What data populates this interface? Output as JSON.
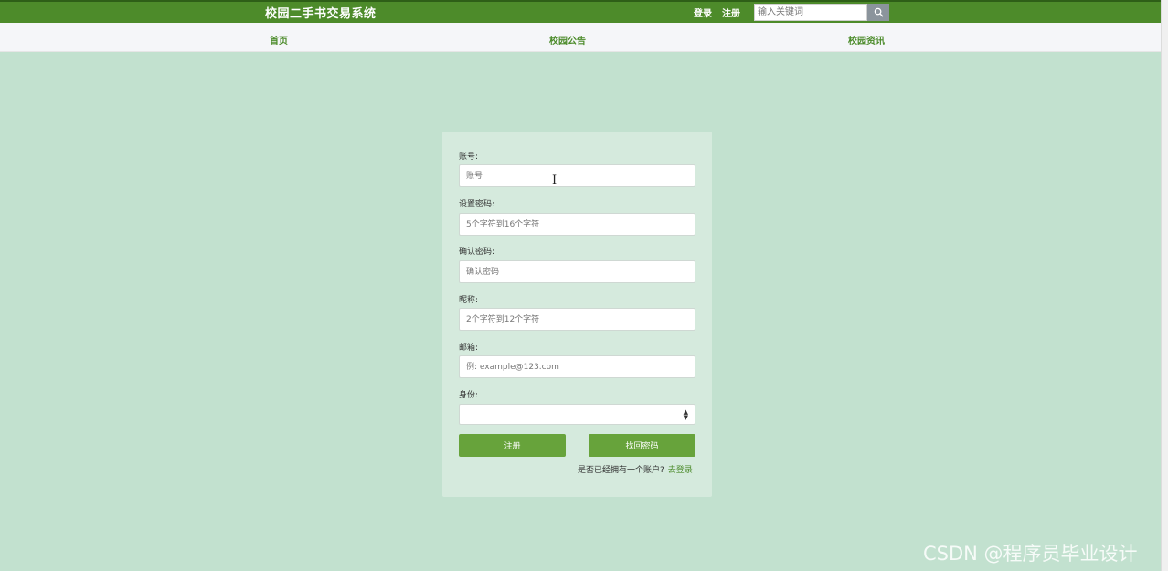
{
  "header": {
    "site_title": "校园二手书交易系统",
    "login_label": "登录",
    "register_label": "注册",
    "search_placeholder": "输入关键词"
  },
  "nav": {
    "items": [
      {
        "label": "首页"
      },
      {
        "label": "校园公告"
      },
      {
        "label": "校园资讯"
      }
    ]
  },
  "form": {
    "fields": [
      {
        "label": "账号:",
        "placeholder": "账号"
      },
      {
        "label": "设置密码:",
        "placeholder": "5个字符到16个字符"
      },
      {
        "label": "确认密码:",
        "placeholder": "确认密码"
      },
      {
        "label": "昵称:",
        "placeholder": "2个字符到12个字符"
      },
      {
        "label": "邮箱:",
        "placeholder": "例: example@123.com"
      }
    ],
    "identity_label": "身份:",
    "identity_value": "",
    "register_button": "注册",
    "find_password_button": "找回密码",
    "login_hint": "是否已经拥有一个账户?",
    "login_link": "去登录"
  },
  "watermark": "CSDN @程序员毕业设计",
  "colors": {
    "header_bg": "#4d8b2a",
    "page_bg": "#c2e1cf",
    "card_bg": "#d5eadd",
    "button_bg": "#67a33b"
  }
}
